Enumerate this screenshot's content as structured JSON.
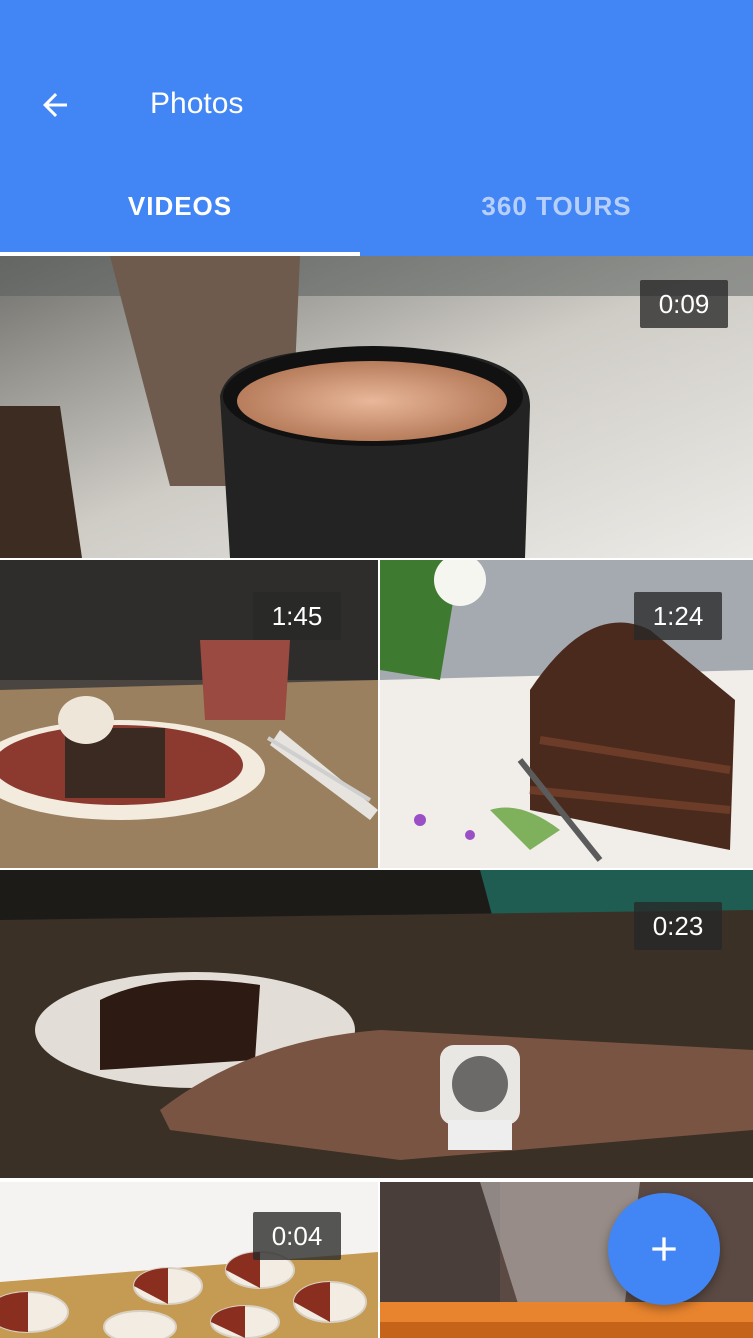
{
  "appbar": {
    "title": "Photos",
    "back_icon": "arrow-left-icon",
    "background_color": "#4285f4"
  },
  "tabs": [
    {
      "label": "VIDEOS",
      "selected": true
    },
    {
      "label": "360 TOURS",
      "selected": false
    }
  ],
  "videos": [
    {
      "subject": "coffee-cup",
      "duration": "0:09"
    },
    {
      "subject": "brownie-with-ice-cream",
      "duration": "1:45"
    },
    {
      "subject": "chocolate-layer-cake",
      "duration": "1:24"
    },
    {
      "subject": "cake-and-wristwatch",
      "duration": "0:23"
    },
    {
      "subject": "black-and-white-cookies",
      "duration": "0:04"
    },
    {
      "subject": "sugar-dusting"
    }
  ],
  "fab": {
    "icon": "plus-icon"
  }
}
